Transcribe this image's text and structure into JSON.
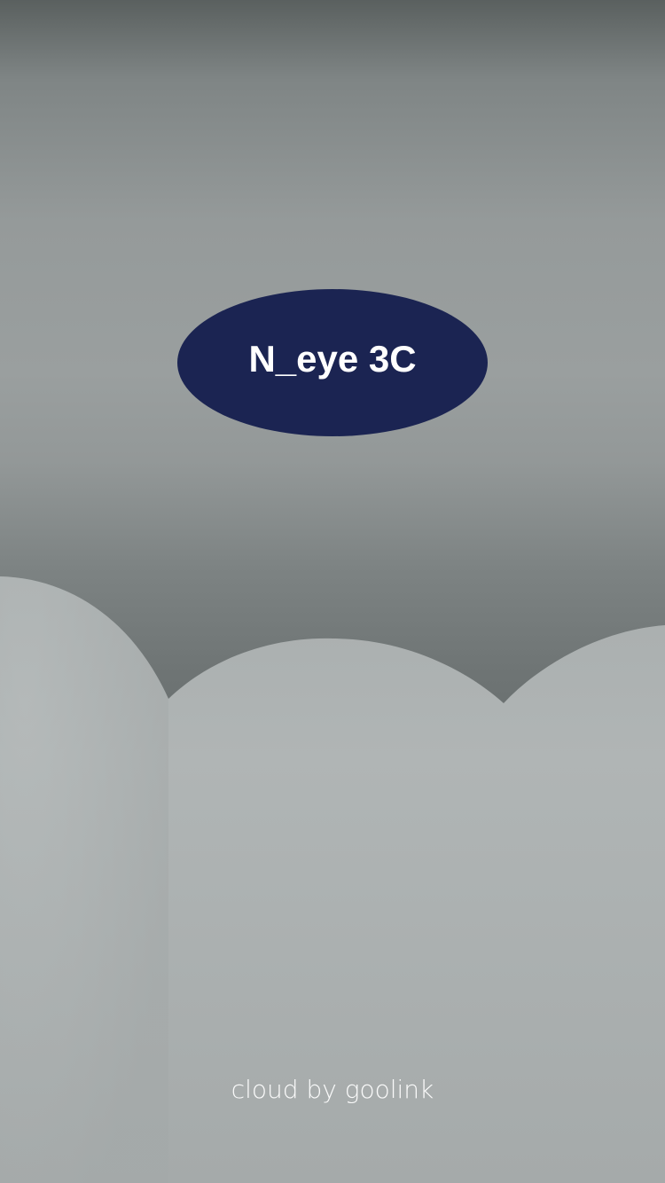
{
  "splash": {
    "logo_text": "N_eye 3C",
    "footer_text": "cloud by goolink"
  },
  "colors": {
    "logo_background": "#1b2452",
    "logo_text": "#ffffff",
    "footer_text": "#ffffff",
    "sky_top": "#5a605f",
    "sky_mid": "#9a9f9f",
    "cloud": "#a8adad"
  },
  "icons": {
    "background": "cloud-shapes"
  }
}
